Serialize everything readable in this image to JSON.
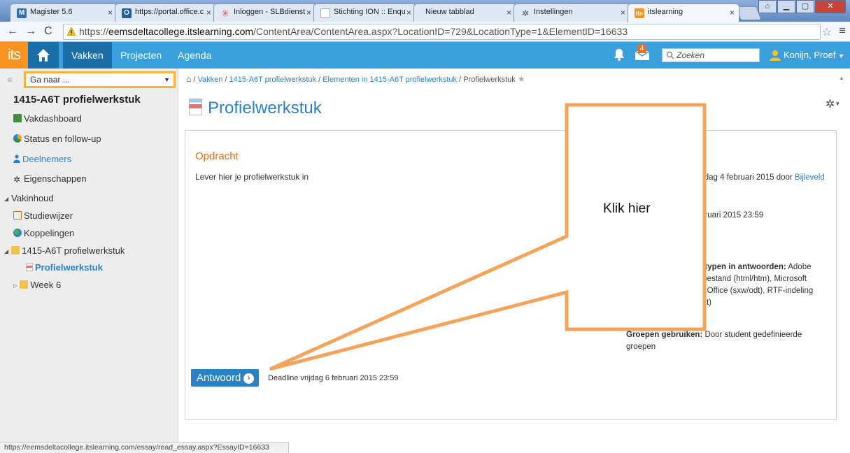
{
  "browser": {
    "tabs": [
      {
        "label": "Magister 5.6",
        "fav_color": "#2e6fb4"
      },
      {
        "label": "https://portal.office.c",
        "fav_color": "#1f5fa8"
      },
      {
        "label": "Inloggen - SLBdienst",
        "fav_color": "#d9534f"
      },
      {
        "label": "Stichting ION :: Enqu",
        "fav_color": "#cccccc"
      },
      {
        "label": "Nieuw tabblad",
        "fav_color": ""
      },
      {
        "label": "Instellingen",
        "fav_color": "#777777"
      },
      {
        "label": "itslearning",
        "fav_color": "#f7931e"
      }
    ],
    "url_prefix": "https://",
    "url_host": "eemsdeltacollege.itslearning.com",
    "url_path": "/ContentArea/ContentArea.aspx?LocationID=729&LocationType=1&ElementID=16633"
  },
  "topnav": {
    "logo": "its",
    "items": [
      "Vakken",
      "Projecten",
      "Agenda"
    ],
    "msg_count": "4",
    "search_placeholder": "Zoeken",
    "user": "Konijn, Proef"
  },
  "sidebar": {
    "goto_placeholder": "Ga naar ...",
    "course_title": "1415-A6T profielwerkstuk",
    "items": [
      "Vakdashboard",
      "Status en follow-up",
      "Deelnemers",
      "Eigenschappen",
      "Vakinhoud",
      "Studiewijzer",
      "Koppelingen",
      "1415-A6T profielwerkstuk",
      "Profielwerkstuk",
      "Week 6"
    ]
  },
  "breadcrumb": {
    "sep": "/",
    "items": [
      "Vakken",
      "1415-A6T profielwerkstuk",
      "Elementen in 1415-A6T profielwerkstuk",
      "Profielwerkstuk"
    ]
  },
  "content": {
    "title": "Profielwerkstuk",
    "heading": "Opdracht",
    "text": "Lever hier je profielwerkstuk in",
    "meta_published_pre": "sdag 4 februari 2015 door ",
    "meta_published_link": "Bijleveld",
    "meta_deadline": "bruari 2015 23:59",
    "meta_types_label": "stypen in antwoorden:",
    "meta_types_value": " Adobe",
    "meta_types_line2": "tbestand (html/htm), Microsoft",
    "meta_types_line3": "n Office (sxw/odt), RTF-indeling",
    "meta_types_line4": "txt)",
    "groups_label": "Groepen gebruiken:",
    "groups_value": " Door student gedefinieerde",
    "groups_line2": "groepen",
    "answer_button": "Antwoord",
    "deadline": "Deadline vrijdag 6 februari 2015 23:59"
  },
  "callout": {
    "text": "Klik hier",
    "color": "#f4a45a"
  },
  "statusbar": {
    "url": "https://eemsdeltacollege.itslearning.com/essay/read_essay.aspx?EssayID=16633"
  }
}
